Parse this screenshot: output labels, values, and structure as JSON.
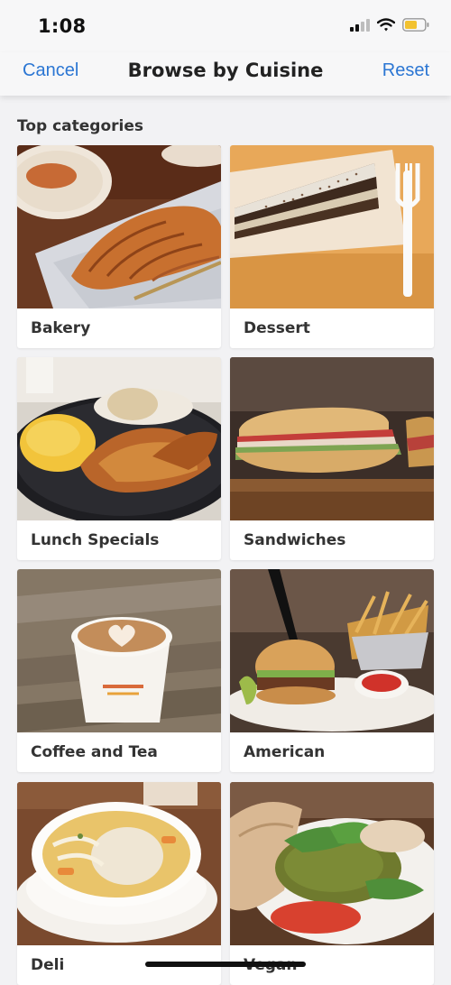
{
  "status_bar": {
    "time": "1:08"
  },
  "nav": {
    "cancel_label": "Cancel",
    "title": "Browse by Cuisine",
    "reset_label": "Reset"
  },
  "section": {
    "title": "Top categories"
  },
  "categories": [
    {
      "label": "Bakery",
      "image": "croissant-photo"
    },
    {
      "label": "Dessert",
      "image": "cake-slice-photo"
    },
    {
      "label": "Lunch Specials",
      "image": "chicken-plate-photo"
    },
    {
      "label": "Sandwiches",
      "image": "sandwich-photo"
    },
    {
      "label": "Coffee and Tea",
      "image": "latte-cup-photo"
    },
    {
      "label": "American",
      "image": "burger-fries-photo"
    },
    {
      "label": "Deli",
      "image": "soup-bowl-photo"
    },
    {
      "label": "Vegan",
      "image": "falafel-pita-photo"
    }
  ],
  "colors": {
    "accent": "#2b76d3",
    "background": "#f2f2f4"
  }
}
